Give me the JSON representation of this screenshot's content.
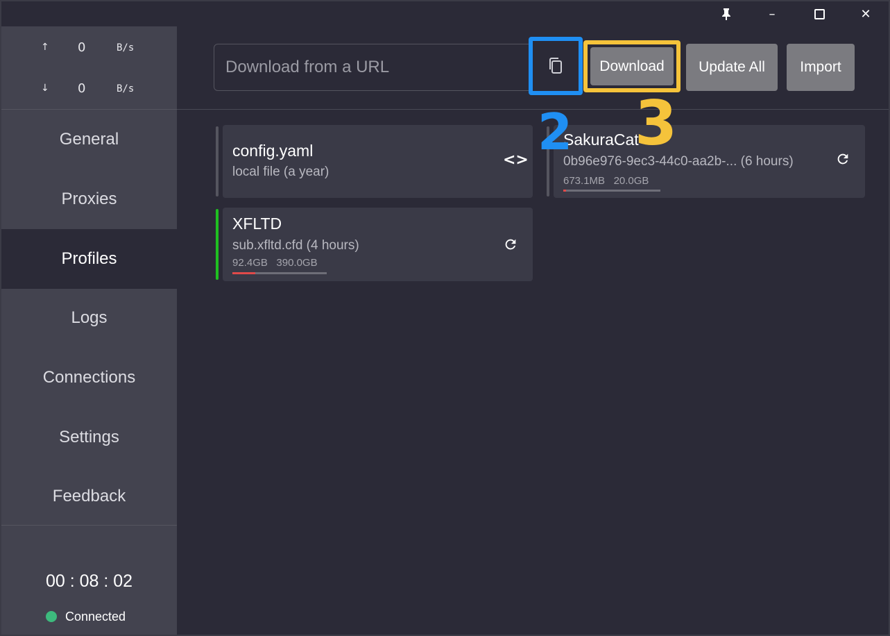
{
  "titlebar": {
    "pin_icon": "pin-icon",
    "minimize": "–",
    "maximize": "☐",
    "close": "✕"
  },
  "traffic": {
    "up": {
      "arrow": "↑",
      "value": "0",
      "unit": "B/s"
    },
    "down": {
      "arrow": "↓",
      "value": "0",
      "unit": "B/s"
    }
  },
  "nav": [
    {
      "label": "General"
    },
    {
      "label": "Proxies"
    },
    {
      "label": "Profiles"
    },
    {
      "label": "Logs"
    },
    {
      "label": "Connections"
    },
    {
      "label": "Settings"
    },
    {
      "label": "Feedback"
    }
  ],
  "footer": {
    "timer": "00 : 08 : 02",
    "status": "Connected",
    "status_color": "#3dba7d"
  },
  "toolbar": {
    "url_placeholder": "Download from a URL",
    "download_label": "Download",
    "update_all_label": "Update All",
    "import_label": "Import"
  },
  "profiles": [
    {
      "title": "config.yaml",
      "subtitle": "local file (a year)",
      "icon": "code-icon",
      "active": false
    },
    {
      "title": "SakuraCat",
      "subtitle": "0b96e976-9ec3-44c0-aa2b-... (6 hours)",
      "used": "673.1MB",
      "total": "20.0GB",
      "usage_fraction": 0.03,
      "icon": "refresh-icon",
      "active": false
    },
    {
      "title": "XFLTD",
      "subtitle": "sub.xfltd.cfd (4 hours)",
      "used": "92.4GB",
      "total": "390.0GB",
      "usage_fraction": 0.24,
      "icon": "refresh-icon",
      "active": true
    }
  ],
  "annotations": {
    "blue_number": "2",
    "yellow_number": "3",
    "blue_color": "#1f8ff3",
    "yellow_color": "#f5c33b"
  }
}
